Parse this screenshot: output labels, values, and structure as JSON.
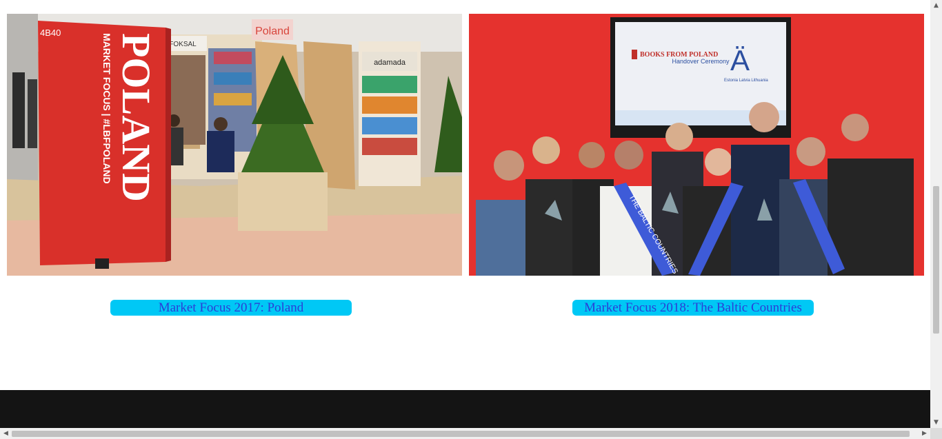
{
  "gallery": {
    "items": [
      {
        "link_label": "Market Focus 2017: Poland",
        "photo": {
          "stand_code": "4B40",
          "banner_title": "POLAND",
          "banner_sub": "MARKET FOCUS  |  #LBFPOLAND",
          "sign_left": "FOKSAL",
          "sign_right": "adamada",
          "sign_top": "Poland"
        }
      },
      {
        "link_label": "Market Focus 2018: The Baltic Countries",
        "photo": {
          "screen_logo": "BOOKS FROM POLAND",
          "screen_text": "Handover Ceremony",
          "screen_mark": "Ä",
          "screen_countries": "Estonia Latvia Lithuania",
          "sash_text": "THE BALTIC COUNTRIES"
        }
      }
    ]
  },
  "colors": {
    "link_bg": "#00c8f5",
    "link_text": "#2b3ed6",
    "footer_bg": "#141414"
  }
}
